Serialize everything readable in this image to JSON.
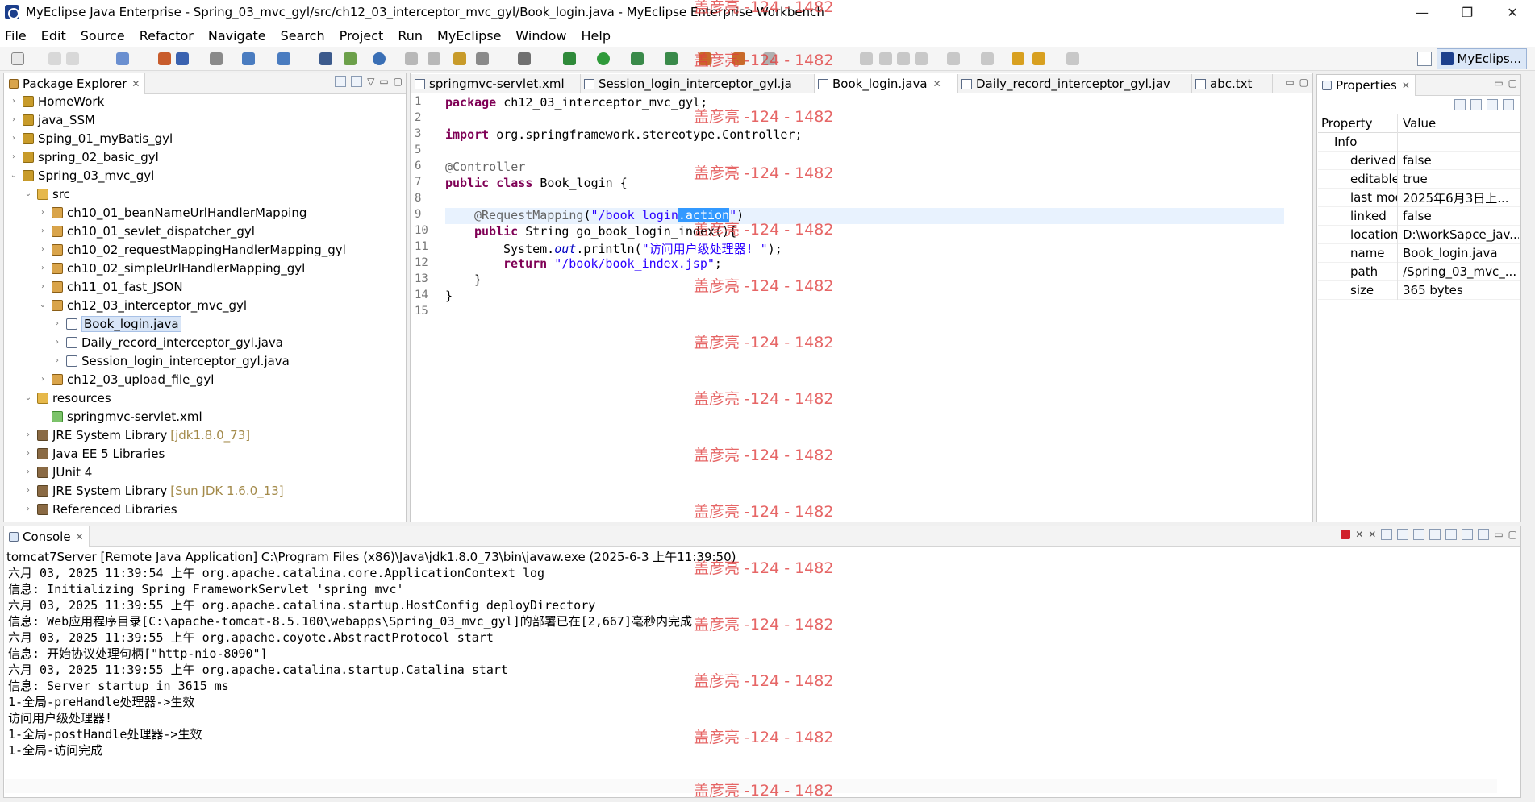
{
  "window": {
    "title": "MyEclipse Java Enterprise - Spring_03_mvc_gyl/src/ch12_03_interceptor_mvc_gyl/Book_login.java - MyEclipse Enterprise Workbench",
    "minimize": "—",
    "maximize": "❐",
    "close": "✕"
  },
  "menu": [
    "File",
    "Edit",
    "Source",
    "Refactor",
    "Navigate",
    "Search",
    "Project",
    "Run",
    "MyEclipse",
    "Window",
    "Help"
  ],
  "perspective": {
    "label": "MyEclips..."
  },
  "package_explorer": {
    "title": "Package Explorer",
    "items": [
      {
        "label": "HomeWork",
        "icon": "project-icon"
      },
      {
        "label": "java_SSM",
        "icon": "project-icon"
      },
      {
        "label": "Sping_01_myBatis_gyl",
        "icon": "project-icon"
      },
      {
        "label": "spring_02_basic_gyl",
        "icon": "project-icon"
      },
      {
        "label": "Spring_03_mvc_gyl",
        "icon": "project-icon"
      },
      {
        "label": "src",
        "icon": "source-folder-icon"
      },
      {
        "label": "ch10_01_beanNameUrlHandlerMapping",
        "icon": "package-icon"
      },
      {
        "label": "ch10_01_sevlet_dispatcher_gyl",
        "icon": "package-icon"
      },
      {
        "label": "ch10_02_requestMappingHandlerMapping_gyl",
        "icon": "package-icon"
      },
      {
        "label": "ch10_02_simpleUrlHandlerMapping_gyl",
        "icon": "package-icon"
      },
      {
        "label": "ch11_01_fast_JSON",
        "icon": "package-icon"
      },
      {
        "label": "ch12_03_interceptor_mvc_gyl",
        "icon": "package-icon"
      },
      {
        "label": "Book_login.java",
        "icon": "java-file-icon"
      },
      {
        "label": "Daily_record_interceptor_gyl.java",
        "icon": "java-file-icon"
      },
      {
        "label": "Session_login_interceptor_gyl.java",
        "icon": "java-file-icon"
      },
      {
        "label": "ch12_03_upload_file_gyl",
        "icon": "package-icon"
      },
      {
        "label": "resources",
        "icon": "source-folder-icon"
      },
      {
        "label": "springmvc-servlet.xml",
        "icon": "xml-file-icon"
      },
      {
        "label": "JRE System Library",
        "suffix": "[jdk1.8.0_73]",
        "icon": "library-icon"
      },
      {
        "label": "Java EE 5 Libraries",
        "icon": "library-icon"
      },
      {
        "label": "JUnit 4",
        "icon": "library-icon"
      },
      {
        "label": "JRE System Library",
        "suffix": "[Sun JDK 1.6.0_13]",
        "icon": "library-icon"
      },
      {
        "label": "Referenced Libraries",
        "icon": "library-icon"
      }
    ]
  },
  "editor": {
    "tabs": [
      {
        "label": "springmvc-servlet.xml"
      },
      {
        "label": "Session_login_interceptor_gyl.ja"
      },
      {
        "label": "Book_login.java",
        "active": true
      },
      {
        "label": "Daily_record_interceptor_gyl.jav"
      },
      {
        "label": "abc.txt"
      }
    ],
    "line_numbers": [
      "1",
      "2",
      "3",
      "5",
      "6",
      "7",
      "8",
      "9",
      "10",
      "11",
      "12",
      "13",
      "14",
      "15"
    ],
    "code": {
      "l1_kw": "package",
      "l1_rest": " ch12_03_interceptor_mvc_gyl;",
      "l3_kw": "import",
      "l3_rest": " org.springframework.stereotype.Controller;",
      "l6": "@Controller",
      "l7_kw": "public class",
      "l7_rest": " Book_login {",
      "l9_ann": "@RequestMapping",
      "l9_open": "(",
      "l9_str": "\"/book_login",
      "l9_sel": ".action",
      "l9_end_str": "\"",
      "l9_close": ")",
      "l10_kw": "public",
      "l10_rest": " String go_book_login_index(){",
      "l11_a": "System.",
      "l11_it": "out",
      "l11_b": ".println(",
      "l11_str": "\"访问用户级处理器! \"",
      "l11_c": ");",
      "l12_kw": "return",
      "l12_str": "\"/book/book_index.jsp\"",
      "l12_c": ";",
      "l13": "}",
      "l14": "}"
    }
  },
  "properties": {
    "title": "Properties",
    "col_property": "Property",
    "col_value": "Value",
    "group": "Info",
    "rows": [
      {
        "key": "derived",
        "value": "false"
      },
      {
        "key": "editable",
        "value": "true"
      },
      {
        "key": "last modified",
        "value": "2025年6月3日上..."
      },
      {
        "key": "linked",
        "value": "false"
      },
      {
        "key": "location",
        "value": "D:\\workSapce_jav..."
      },
      {
        "key": "name",
        "value": "Book_login.java"
      },
      {
        "key": "path",
        "value": "/Spring_03_mvc_..."
      },
      {
        "key": "size",
        "value": "365  bytes"
      }
    ]
  },
  "console": {
    "title": "Console",
    "process": "tomcat7Server [Remote Java Application] C:\\Program Files (x86)\\Java\\jdk1.8.0_73\\bin\\javaw.exe (2025-6-3 上午11:39:50)",
    "lines": [
      "六月 03, 2025 11:39:54 上午 org.apache.catalina.core.ApplicationContext log",
      "信息: Initializing Spring FrameworkServlet 'spring_mvc'",
      "六月 03, 2025 11:39:55 上午 org.apache.catalina.startup.HostConfig deployDirectory",
      "信息: Web应用程序目录[C:\\apache-tomcat-8.5.100\\webapps\\Spring_03_mvc_gyl]的部署已在[2,667]毫秒内完成",
      "六月 03, 2025 11:39:55 上午 org.apache.coyote.AbstractProtocol start",
      "信息: 开始协议处理句柄[\"http-nio-8090\"]",
      "六月 03, 2025 11:39:55 上午 org.apache.catalina.startup.Catalina start",
      "信息: Server startup in 3615 ms",
      "1-全局-preHandle处理器->生效",
      "访问用户级处理器!",
      "1-全局-postHandle处理器->生效",
      "1-全局-访问完成"
    ]
  },
  "watermark": "盖彦亮 -124 - 1482",
  "colors": {
    "keyword": "#7f0055",
    "string": "#2a00ff",
    "selection": "#3399ff",
    "watermark": "#e04040"
  }
}
